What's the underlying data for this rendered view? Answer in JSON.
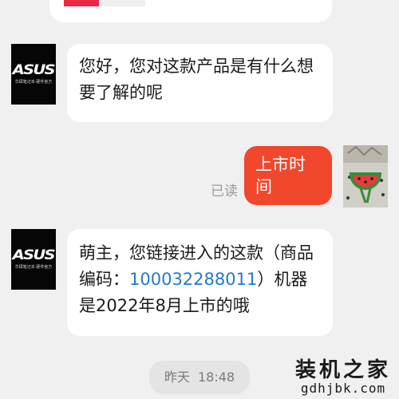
{
  "messages": {
    "agent_greeting": "您好，您对这款产品是有什么想要了解的呢",
    "user_question": "上市时间",
    "read_status": "已读",
    "agent_reply_before_link": "萌主，您链接进入的这款（商品编码：",
    "agent_reply_link": "100032288011",
    "agent_reply_after_link": "）机器是2022年8月上市的哦"
  },
  "agent_avatar": {
    "logo_text": "ASUS",
    "sub_text": "华硕笔记本·硬件官方"
  },
  "timestamp": {
    "day": "昨天",
    "time": "18:48"
  },
  "watermark": {
    "title": "装机之家",
    "url": "gdhjbk.com"
  },
  "colors": {
    "background": "#f0f0f0",
    "user_bubble": "#f0472d",
    "link": "#2379cc",
    "read_status": "#9a9a9a"
  }
}
